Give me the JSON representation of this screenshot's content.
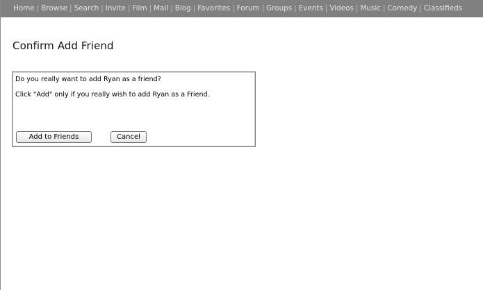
{
  "nav": {
    "items": [
      {
        "label": "Home"
      },
      {
        "label": "Browse"
      },
      {
        "label": "Search"
      },
      {
        "label": "Invite"
      },
      {
        "label": "Film"
      },
      {
        "label": "Mail"
      },
      {
        "label": "Blog"
      },
      {
        "label": "Favorites"
      },
      {
        "label": "Forum"
      },
      {
        "label": "Groups"
      },
      {
        "label": "Events"
      },
      {
        "label": "Videos"
      },
      {
        "label": "Music"
      },
      {
        "label": "Comedy"
      },
      {
        "label": "Classifieds"
      }
    ],
    "separator": "|"
  },
  "page": {
    "title": "Confirm Add Friend"
  },
  "dialog": {
    "question": "Do you really want to add Ryan as a friend?",
    "instruction": "Click \"Add\" only if you really wish to add Ryan as a Friend.",
    "add_button_label": "Add to Friends",
    "cancel_button_label": "Cancel"
  },
  "colors": {
    "nav_background": "#808080",
    "nav_text": "#e3e3e3",
    "box_border": "#7e7e7e"
  }
}
